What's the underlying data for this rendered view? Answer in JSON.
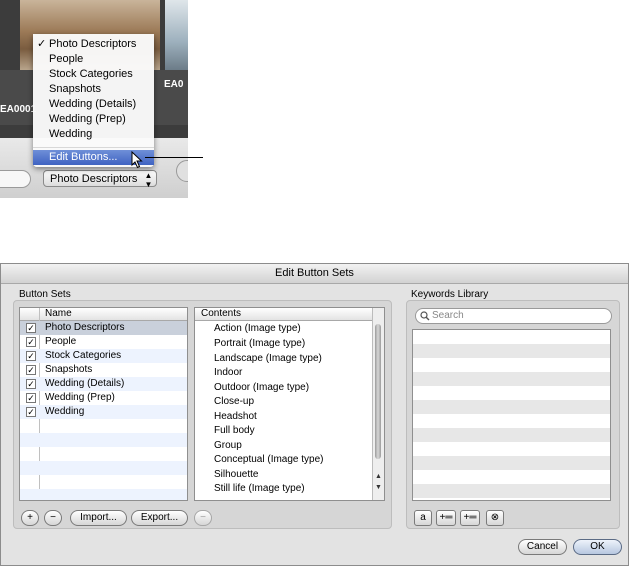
{
  "snippet": {
    "filenames": [
      "EA0001",
      "EA0"
    ],
    "popup_menu": {
      "checkmark": "✓",
      "items": [
        "Photo Descriptors",
        "People",
        "Stock Categories",
        "Snapshots",
        "Wedding (Details)",
        "Wedding (Prep)",
        "Wedding"
      ],
      "edit_item": "Edit Buttons..."
    },
    "popup_button": {
      "value": "Photo Descriptors",
      "arrows": "▲▼"
    }
  },
  "dialog": {
    "title": "Edit Button Sets",
    "button_sets": {
      "label": "Button Sets",
      "column_name": "Name",
      "check_mark": "✓",
      "rows": [
        "Photo Descriptors",
        "People",
        "Stock Categories",
        "Snapshots",
        "Wedding (Details)",
        "Wedding (Prep)",
        "Wedding"
      ],
      "selected_index": 0,
      "add_label": "+",
      "remove_label": "−",
      "import_label": "Import...",
      "export_label": "Export..."
    },
    "contents": {
      "column_title": "Contents",
      "items": [
        "Action (Image type)",
        "Portrait (Image type)",
        "Landscape (Image type)",
        "Indoor",
        "Outdoor (Image type)",
        "Close-up",
        "Headshot",
        "Full body",
        "Group",
        "Conceptual (Image type)",
        "Silhouette",
        "Still life (Image type)"
      ],
      "remove_label": "−"
    },
    "keywords_library": {
      "label": "Keywords Library",
      "search_placeholder": "Search",
      "tool_buttons": [
        "a",
        "+═",
        "+═",
        "⊗"
      ]
    },
    "cancel_label": "Cancel",
    "ok_label": "OK"
  }
}
